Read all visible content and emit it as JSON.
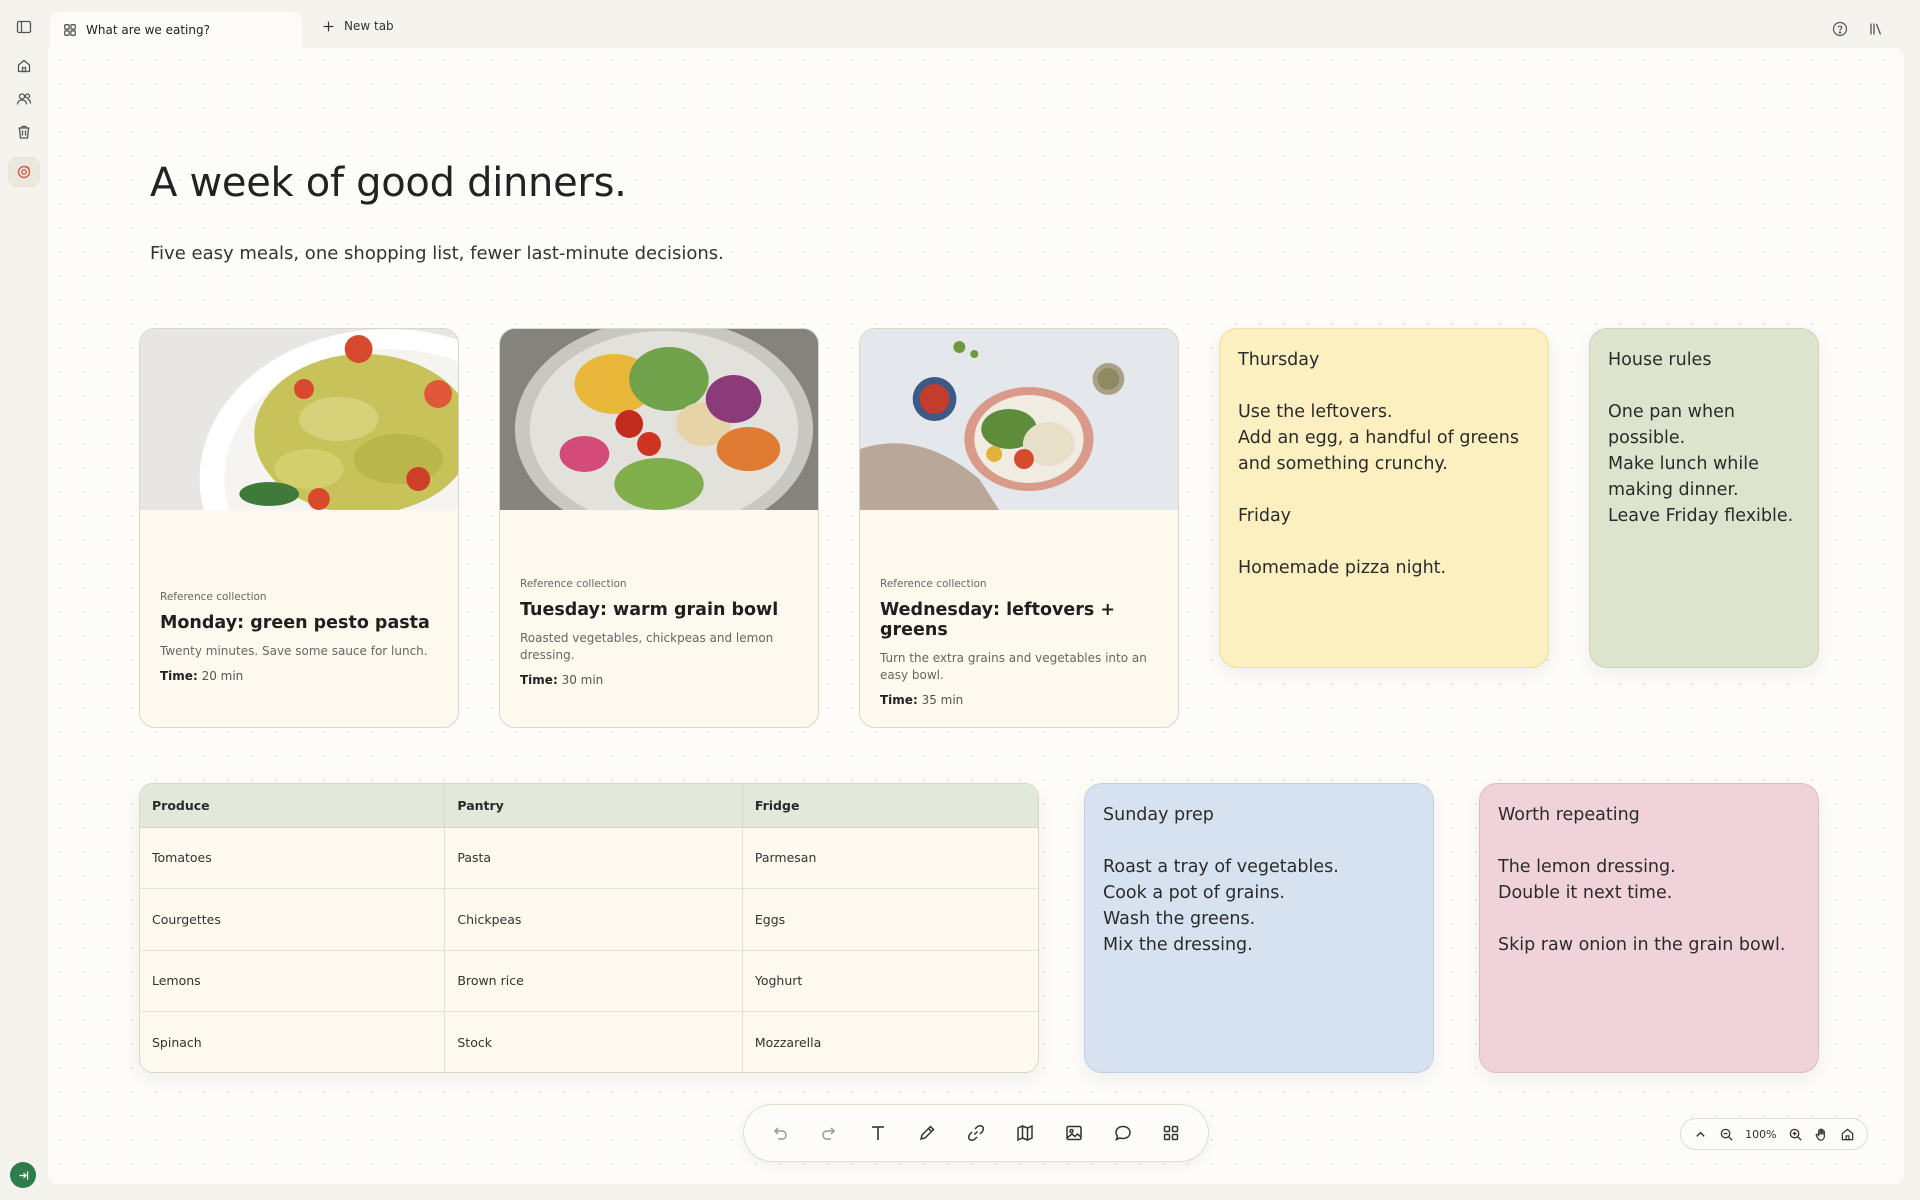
{
  "tabs": {
    "active_label": "What are we eating?",
    "new_tab_label": "New tab"
  },
  "page": {
    "title": "A week of good dinners.",
    "subtitle": "Five easy meals, one shopping list, fewer last-minute decisions."
  },
  "cards": [
    {
      "eyebrow": "Reference collection",
      "title": "Monday: green pesto pasta",
      "desc": "Twenty minutes. Save some sauce for lunch.",
      "time_label": "Time:",
      "time_value": "20 min"
    },
    {
      "eyebrow": "Reference collection",
      "title": "Tuesday: warm grain bowl",
      "desc": "Roasted vegetables, chickpeas and lemon dressing.",
      "time_label": "Time:",
      "time_value": "30 min"
    },
    {
      "eyebrow": "Reference collection",
      "title": "Wednesday: leftovers + greens",
      "desc": "Turn the extra grains and vegetables into an easy bowl.",
      "time_label": "Time:",
      "time_value": "35 min"
    }
  ],
  "stickies": {
    "thursday": "Thursday\n\nUse the leftovers.\nAdd an egg, a handful of greens\nand something crunchy.\n\nFriday\n\nHomemade pizza night.",
    "house_rules": "House rules\n\nOne pan when\npossible.\nMake lunch while\nmaking dinner.\nLeave Friday flexible.",
    "sunday_prep": "Sunday prep\n\nRoast a tray of vegetables.\nCook a pot of grains.\nWash the greens.\nMix the dressing.",
    "worth_repeating": "Worth repeating\n\nThe lemon dressing.\nDouble it next time.\n\nSkip raw onion in the grain bowl."
  },
  "shopping_table": {
    "headers": [
      "Produce",
      "Pantry",
      "Fridge"
    ],
    "rows": [
      [
        "Tomatoes",
        "Pasta",
        "Parmesan"
      ],
      [
        "Courgettes",
        "Chickpeas",
        "Eggs"
      ],
      [
        "Lemons",
        "Brown rice",
        "Yoghurt"
      ],
      [
        "Spinach",
        "Stock",
        "Mozzarella"
      ]
    ]
  },
  "zoom": {
    "level": "100%"
  },
  "colors": {
    "accent_active": "#c9634a",
    "exit_button": "#2f7d4c",
    "sticky_yellow": "#fdf0c0",
    "sticky_green": "#dde4ce",
    "sticky_blue": "#d6e2ef",
    "sticky_pink": "#f0d3da",
    "table_header": "#e2e9da"
  }
}
